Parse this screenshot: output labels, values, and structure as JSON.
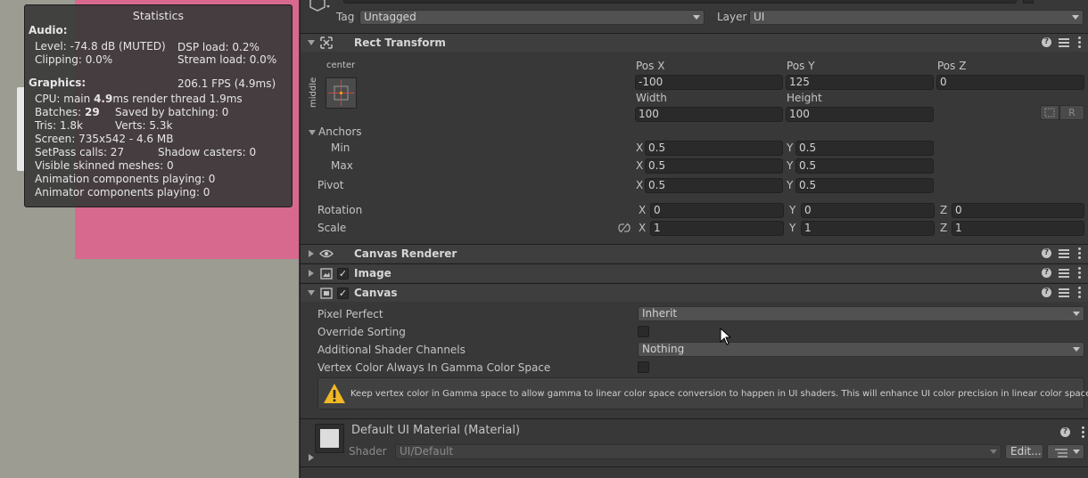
{
  "statistics": {
    "title": "Statistics",
    "audio_header": "Audio:",
    "level": "Level: -74.8 dB (MUTED)",
    "dsp_load": "DSP load: 0.2%",
    "clipping": "Clipping: 0.0%",
    "stream_load": "Stream load: 0.0%",
    "graphics_header": "Graphics:",
    "fps": "206.1 FPS (4.9ms)",
    "cpu_prefix": "CPU: main ",
    "cpu_main": "4.9",
    "cpu_suffix": "ms  render thread 1.9ms",
    "batches_prefix": "Batches: ",
    "batches": "29",
    "saved_by_batching": "Saved by batching: 0",
    "tris": "Tris: 1.8k",
    "verts": "Verts: 5.3k",
    "screen": "Screen: 735x542 - 4.6 MB",
    "setpass": "SetPass calls: 27",
    "shadow_casters": "Shadow casters: 0",
    "skinned_meshes": "Visible skinned meshes: 0",
    "animation_components": "Animation components playing: 0",
    "animator_components": "Animator components playing: 0"
  },
  "object": {
    "tag_label": "Tag",
    "tag_value": "Untagged",
    "layer_label": "Layer",
    "layer_value": "UI"
  },
  "rect_transform": {
    "title": "Rect Transform",
    "anchor_preset_top": "center",
    "anchor_preset_side": "middle",
    "pos_x_label": "Pos X",
    "pos_y_label": "Pos Y",
    "pos_z_label": "Pos Z",
    "pos_x": "-100",
    "pos_y": "125",
    "pos_z": "0",
    "width_label": "Width",
    "height_label": "Height",
    "width": "100",
    "height": "100",
    "r_button": "R",
    "anchors_label": "Anchors",
    "min_label": "Min",
    "min_x": "0.5",
    "min_y": "0.5",
    "max_label": "Max",
    "max_x": "0.5",
    "max_y": "0.5",
    "pivot_label": "Pivot",
    "pivot_x": "0.5",
    "pivot_y": "0.5",
    "rotation_label": "Rotation",
    "rot_x": "0",
    "rot_y": "0",
    "rot_z": "0",
    "scale_label": "Scale",
    "scale_x": "1",
    "scale_y": "1",
    "scale_z": "1",
    "x": "X",
    "y": "Y",
    "z": "Z"
  },
  "canvas_renderer": {
    "title": "Canvas Renderer"
  },
  "image": {
    "title": "Image"
  },
  "canvas": {
    "title": "Canvas",
    "pixel_perfect_label": "Pixel Perfect",
    "pixel_perfect_value": "Inherit",
    "override_sorting_label": "Override Sorting",
    "shader_channels_label": "Additional Shader Channels",
    "shader_channels_value": "Nothing",
    "vertex_color_label": "Vertex Color Always In Gamma Color Space",
    "warning": "Keep vertex color in Gamma space to allow gamma to linear color space conversion to happen in UI shaders. This will enhance UI color precision in linear color space."
  },
  "material": {
    "title": "Default UI Material (Material)",
    "shader_label": "Shader",
    "shader_value": "UI/Default",
    "edit_button": "Edit..."
  }
}
